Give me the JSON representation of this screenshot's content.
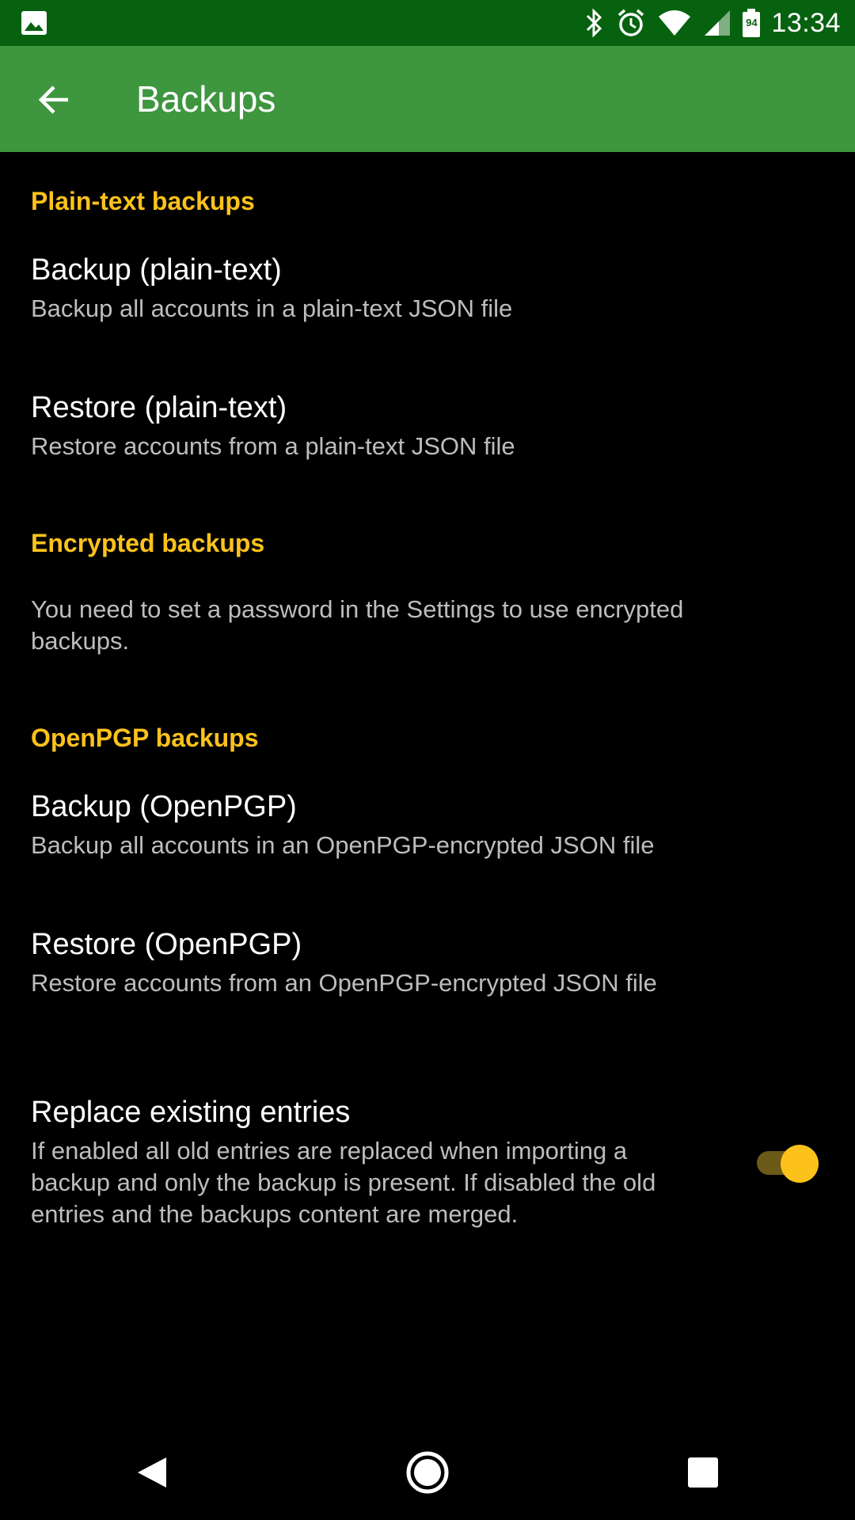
{
  "status_bar": {
    "time": "13:34",
    "battery_level": "94",
    "icons": [
      "image-icon",
      "bluetooth-icon",
      "alarm-icon",
      "wifi-icon",
      "signal-icon",
      "battery-icon"
    ]
  },
  "app_bar": {
    "title": "Backups",
    "back_icon": "arrow-left-icon"
  },
  "sections": {
    "plain": {
      "header": "Plain-text backups",
      "backup_title": "Backup (plain-text)",
      "backup_summary": "Backup all accounts in a plain-text JSON file",
      "restore_title": "Restore (plain-text)",
      "restore_summary": "Restore accounts from a plain-text JSON file"
    },
    "encrypted": {
      "header": "Encrypted backups",
      "message_line1": "You need to set a password in the Settings to use encrypted",
      "message_line2": "backups."
    },
    "openpgp": {
      "header": "OpenPGP backups",
      "backup_title": "Backup (OpenPGP)",
      "backup_summary": "Backup all accounts in an OpenPGP-encrypted JSON file",
      "restore_title": "Restore (OpenPGP)",
      "restore_summary": "Restore accounts from an OpenPGP-encrypted JSON file"
    },
    "replace": {
      "title": "Replace existing entries",
      "summary_line1": "If enabled all old entries are replaced when importing a",
      "summary_line2": "backup and only the backup is present. If disabled the old",
      "summary_line3": "entries and the backups content are merged.",
      "enabled": true
    }
  },
  "colors": {
    "status_bar": "#06620f",
    "app_bar": "#3e963f",
    "accent": "#fcc21b",
    "background": "#000000"
  },
  "nav_bar": {
    "icons": [
      "back-triangle-icon",
      "home-circle-icon",
      "recents-square-icon"
    ]
  }
}
